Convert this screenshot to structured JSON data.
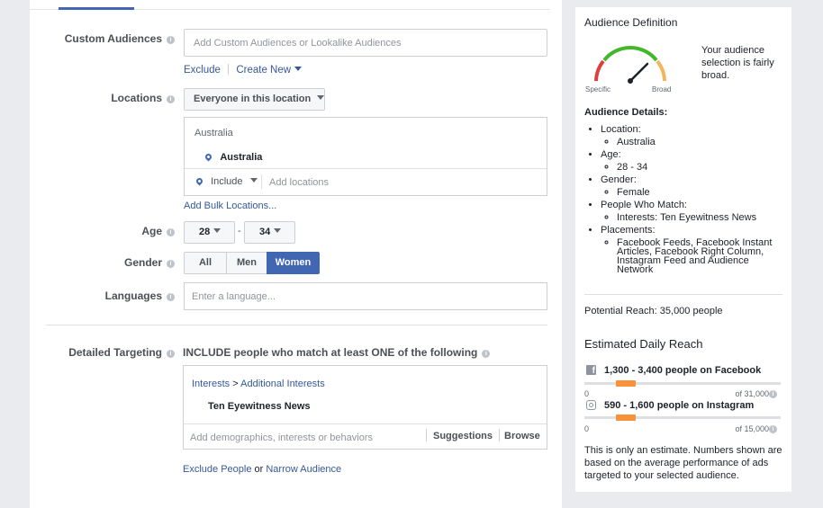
{
  "form": {
    "custom_audiences": {
      "label": "Custom Audiences",
      "placeholder": "Add Custom Audiences or Lookalike Audiences",
      "exclude": "Exclude",
      "create_new": "Create New"
    },
    "locations": {
      "label": "Locations",
      "dropdown": "Everyone in this location",
      "country_header": "Australia",
      "selected": "Australia",
      "include": "Include",
      "add_placeholder": "Add locations",
      "bulk": "Add Bulk Locations..."
    },
    "age": {
      "label": "Age",
      "min": "28",
      "max": "34",
      "separator": "-"
    },
    "gender": {
      "label": "Gender",
      "options": [
        "All",
        "Men",
        "Women"
      ],
      "selected": "Women"
    },
    "languages": {
      "label": "Languages",
      "placeholder": "Enter a language..."
    },
    "detailed_targeting": {
      "label": "Detailed Targeting",
      "include_text": "INCLUDE people who match at least ONE of the following",
      "breadcrumb_1": "Interests",
      "breadcrumb_sep": ">",
      "breadcrumb_2": "Additional Interests",
      "item": "Ten Eyewitness News",
      "placeholder": "Add demographics, interests or behaviors",
      "suggestions": "Suggestions",
      "browse": "Browse",
      "exclude_people": "Exclude People",
      "or": "or",
      "narrow": "Narrow Audience"
    }
  },
  "sidebar": {
    "definition_title": "Audience Definition",
    "gauge_text": "Your audience selection is fairly broad.",
    "gauge_left": "Specific",
    "gauge_right": "Broad",
    "gauge_level": "fairly broad",
    "details_title": "Audience Details:",
    "details": [
      {
        "label": "Location:",
        "value": "Australia"
      },
      {
        "label": "Age:",
        "value": "28 - 34"
      },
      {
        "label": "Gender:",
        "value": "Female"
      },
      {
        "label": "People Who Match:",
        "value": "Interests: Ten Eyewitness News"
      },
      {
        "label": "Placements:",
        "value": "Facebook Feeds, Facebook Instant Articles, Facebook Right Column, Instagram Feed and Audience Network"
      }
    ],
    "potential_reach": "Potential Reach: 35,000 people",
    "daily_title": "Estimated Daily Reach",
    "facebook": {
      "text": "1,300 - 3,400 people on Facebook",
      "min": "0",
      "max": "of 31,000"
    },
    "instagram": {
      "text": "590 - 1,600 people on Instagram",
      "min": "0",
      "max": "of 15,000"
    },
    "estimate_note": "This is only an estimate. Numbers shown are based on the average performance of ads targeted to your selected audience."
  },
  "colors": {
    "accent": "#4267b2",
    "link": "#365899",
    "reach_bar": "#f7923b"
  }
}
